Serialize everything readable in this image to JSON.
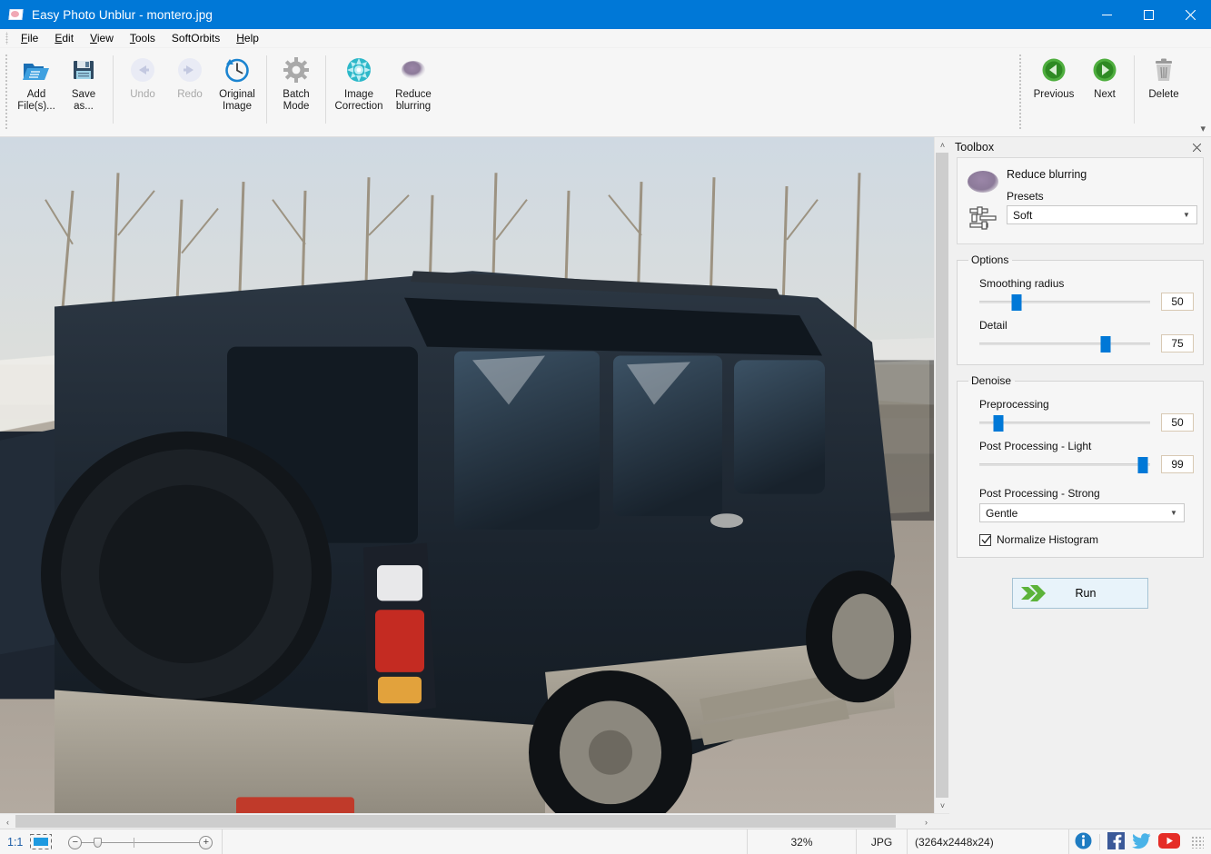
{
  "window": {
    "title": "Easy Photo Unblur - montero.jpg",
    "app_icon": "photo-unblur-icon",
    "minimize": "minimize-button",
    "maximize": "maximize-button",
    "close": "close-button",
    "accent": "#0078d7"
  },
  "menubar": {
    "items": [
      {
        "label": "File",
        "accel": "F"
      },
      {
        "label": "Edit",
        "accel": "E"
      },
      {
        "label": "View",
        "accel": "V"
      },
      {
        "label": "Tools",
        "accel": "T"
      },
      {
        "label": "SoftOrbits",
        "accel": ""
      },
      {
        "label": "Help",
        "accel": "H"
      }
    ]
  },
  "toolbar": {
    "left_buttons": [
      {
        "name": "add-files",
        "line1": "Add",
        "line2": "File(s)...",
        "icon": "open-folder-icon",
        "enabled": true
      },
      {
        "name": "save-as",
        "line1": "Save",
        "line2": "as...",
        "icon": "floppy-disk-icon",
        "enabled": true
      },
      {
        "name": "undo",
        "line1": "Undo",
        "line2": "",
        "icon": "undo-arrow-icon",
        "enabled": false
      },
      {
        "name": "redo",
        "line1": "Redo",
        "line2": "",
        "icon": "redo-arrow-icon",
        "enabled": false
      },
      {
        "name": "original-image",
        "line1": "Original",
        "line2": "Image",
        "icon": "clock-history-icon",
        "enabled": true
      },
      {
        "name": "batch-mode",
        "line1": "Batch",
        "line2": "Mode",
        "icon": "gear-icon",
        "enabled": true
      },
      {
        "name": "image-correction",
        "line1": "Image",
        "line2": "Correction",
        "icon": "color-burst-icon",
        "enabled": true
      },
      {
        "name": "reduce-blurring",
        "line1": "Reduce",
        "line2": "blurring",
        "icon": "blur-ellipse-icon",
        "enabled": true
      }
    ],
    "right_buttons": [
      {
        "name": "previous",
        "line1": "Previous",
        "line2": "",
        "icon": "prev-circle-icon",
        "enabled": true
      },
      {
        "name": "next",
        "line1": "Next",
        "line2": "",
        "icon": "next-circle-icon",
        "enabled": true
      },
      {
        "name": "delete",
        "line1": "Delete",
        "line2": "",
        "icon": "trash-icon",
        "enabled": true
      }
    ],
    "overflow": "▾"
  },
  "toolbox": {
    "header": "Toolbox",
    "close": "close-toolbox-icon",
    "tool_title": "Reduce blurring",
    "presets_label": "Presets",
    "presets_value": "Soft",
    "options": {
      "legend": "Options",
      "sliders": [
        {
          "name": "smoothing-radius",
          "label": "Smoothing radius",
          "value": "50",
          "percent": 22
        },
        {
          "name": "detail",
          "label": "Detail",
          "value": "75",
          "percent": 74
        }
      ]
    },
    "denoise": {
      "legend": "Denoise",
      "sliders": [
        {
          "name": "preprocessing",
          "label": "Preprocessing",
          "value": "50",
          "percent": 11
        },
        {
          "name": "post-processing-light",
          "label": "Post Processing - Light",
          "value": "99",
          "percent": 96
        }
      ],
      "strong_label": "Post Processing - Strong",
      "strong_value": "Gentle",
      "normalize_label": "Normalize Histogram",
      "normalize_checked": true
    },
    "run_label": "Run"
  },
  "statusbar": {
    "ratio": "1:1",
    "fit_icon": "fit-to-window-icon",
    "zoom_minus": "−",
    "zoom_plus": "+",
    "zoom_percent": "32%",
    "format": "JPG",
    "dimensions": "(3264x2448x24)",
    "social": [
      {
        "name": "info-icon",
        "label": "i"
      },
      {
        "name": "facebook-icon",
        "label": "f"
      },
      {
        "name": "twitter-icon",
        "label": ""
      },
      {
        "name": "youtube-icon",
        "label": ""
      }
    ]
  },
  "canvas": {
    "alt": "photograph of a dark blue SUV parked on gravel in front of bare trees",
    "scroll_up": "˄",
    "scroll_down": "˅",
    "scroll_left": "‹",
    "scroll_right": "›"
  }
}
